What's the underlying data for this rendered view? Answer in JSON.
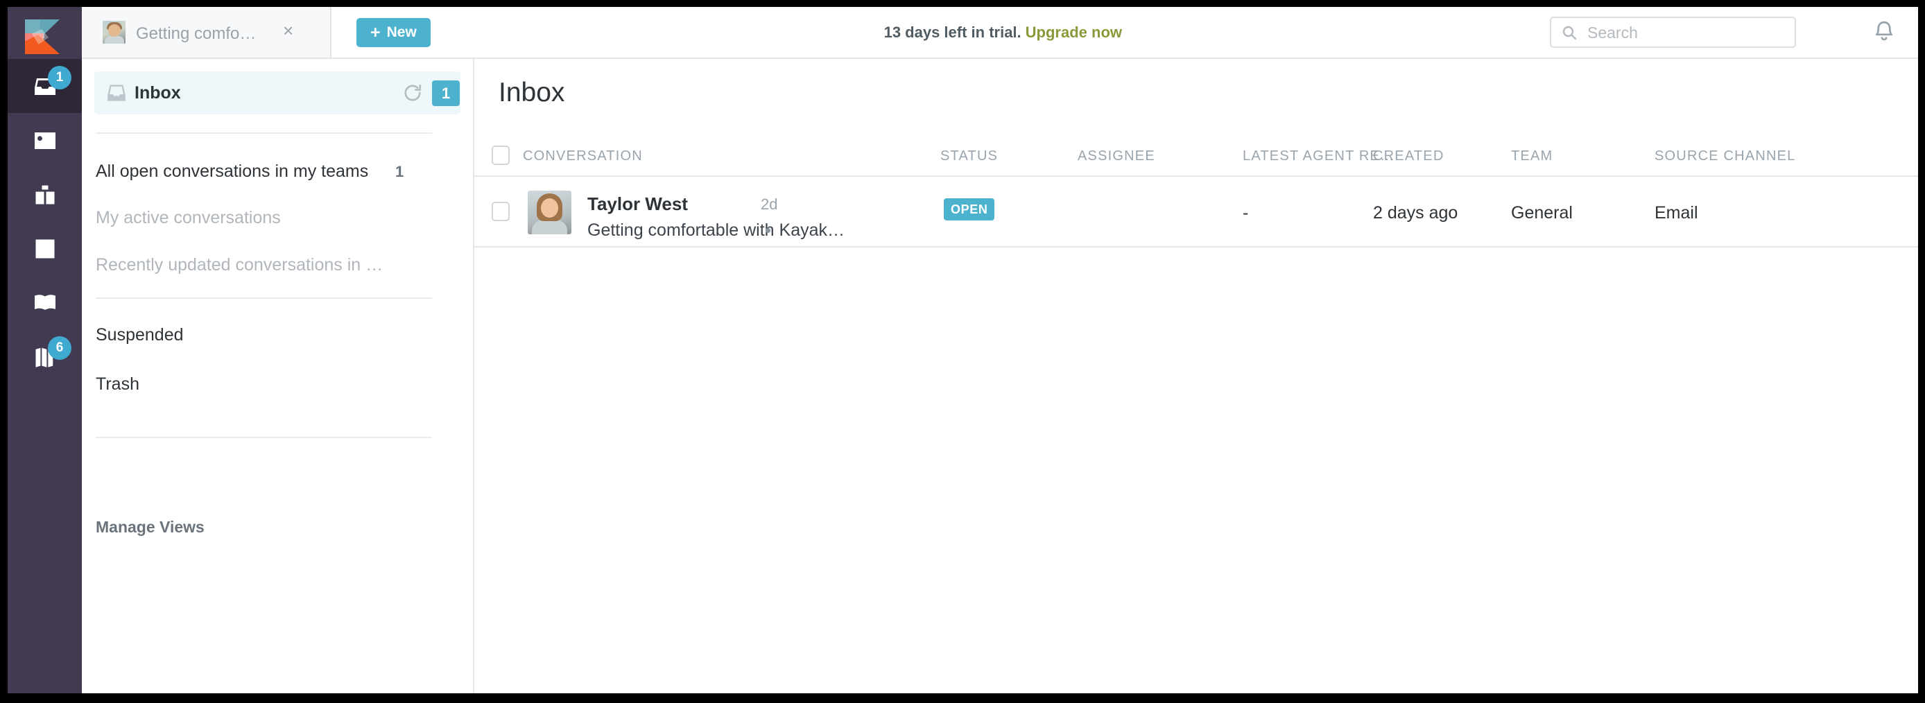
{
  "app": {
    "logo_name": "kayako-logo"
  },
  "topbar": {
    "tab": {
      "title": "Getting comfo…",
      "close_label": "×",
      "avatar_name": "tab-avatar"
    },
    "new_button": {
      "plus": "+",
      "label": "New"
    },
    "trial": {
      "text": "13 days left in trial.",
      "upgrade_label": "Upgrade now"
    },
    "search": {
      "placeholder": "Search",
      "value": ""
    },
    "notifications_icon": "bell-icon",
    "user": {
      "avatar_name": "user-avatar",
      "status": "online"
    }
  },
  "rail": {
    "items": [
      {
        "name": "inbox",
        "badge": "1",
        "active": true
      },
      {
        "name": "contacts",
        "badge": "",
        "active": false
      },
      {
        "name": "organizations",
        "badge": "",
        "active": false
      },
      {
        "name": "reports",
        "badge": "",
        "active": false
      },
      {
        "name": "knowledge-base",
        "badge": "",
        "active": false
      },
      {
        "name": "guides",
        "badge": "6",
        "active": false
      }
    ]
  },
  "views": {
    "header": {
      "title": "Inbox",
      "count": "1",
      "refresh_icon": "refresh-icon",
      "inbox_icon": "inbox-icon"
    },
    "items": [
      {
        "label": "All open conversations in my teams",
        "count": "1",
        "muted": false
      },
      {
        "label": "My active conversations",
        "count": "",
        "muted": true
      },
      {
        "label": "Recently updated conversations in …",
        "count": "",
        "muted": true
      },
      {
        "label": "Suspended",
        "count": "",
        "muted": false
      },
      {
        "label": "Trash",
        "count": "",
        "muted": false
      }
    ],
    "manage_label": "Manage Views"
  },
  "main": {
    "title": "Inbox",
    "columns": [
      "CONVERSATION",
      "STATUS",
      "ASSIGNEE",
      "LATEST AGENT RE…",
      "CREATED",
      "TEAM",
      "SOURCE CHANNEL"
    ],
    "rows": [
      {
        "name": "Taylor West",
        "age": "2d",
        "subject": "Getting comfortable with Kayak…",
        "status": "OPEN",
        "assignee": "",
        "latest_agent_reply": "-",
        "created": "2 days ago",
        "team": "General",
        "source_channel": "Email"
      }
    ]
  },
  "colors": {
    "rail_bg": "#413a50",
    "rail_active_bg": "#2d2738",
    "accent": "#4cb2ce",
    "badge": "#3fa9cf",
    "upgrade_link": "#8a9a3b",
    "status_online": "#46b65c",
    "views_header_bg": "#eef7fa"
  }
}
